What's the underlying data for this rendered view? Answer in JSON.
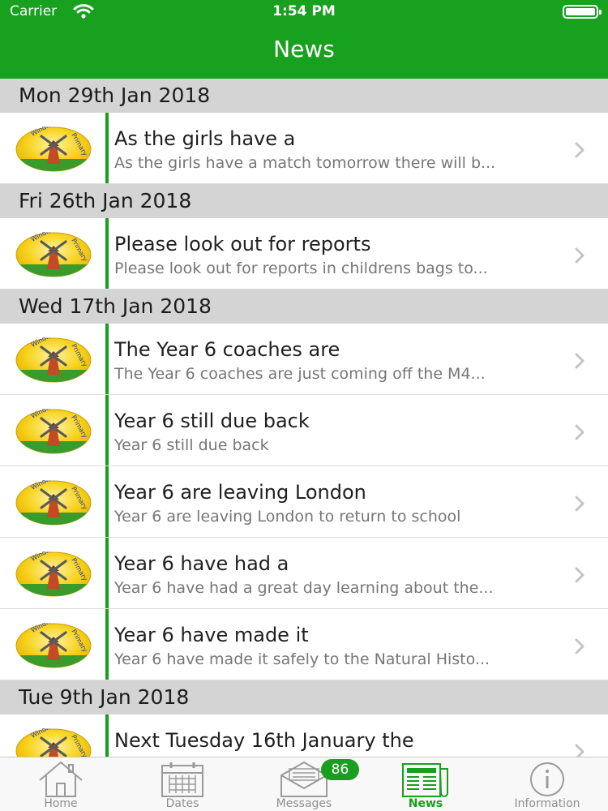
{
  "status_bar": {
    "carrier": "Carrier",
    "time": "1:54 PM"
  },
  "nav": {
    "title": "News"
  },
  "logo": {
    "text_top": "Windmill",
    "text_side": "Primary"
  },
  "colors": {
    "accent": "#17a11e",
    "section_bg": "#d4d4d4",
    "subtitle": "#767676"
  },
  "sections": [
    {
      "date": "Mon 29th Jan 2018",
      "items": [
        {
          "title": "As the girls have a",
          "subtitle": "As the girls have a match tomorrow there will b..."
        }
      ]
    },
    {
      "date": "Fri 26th Jan 2018",
      "items": [
        {
          "title": "Please look out for reports",
          "subtitle": "Please look out for reports in childrens bags to..."
        }
      ]
    },
    {
      "date": "Wed 17th Jan 2018",
      "items": [
        {
          "title": "The Year 6 coaches are",
          "subtitle": "The Year 6 coaches are just coming off the M4..."
        },
        {
          "title": "Year 6 still due back",
          "subtitle": "Year 6 still due back"
        },
        {
          "title": "Year 6 are leaving London",
          "subtitle": "Year 6 are leaving London to return to school"
        },
        {
          "title": "Year 6 have had a",
          "subtitle": "Year 6 have had a great day learning about the..."
        },
        {
          "title": "Year 6 have made it",
          "subtitle": "Year 6 have made it safely to the Natural Histo..."
        }
      ]
    },
    {
      "date": "Tue 9th Jan 2018",
      "items": [
        {
          "title": "Next Tuesday 16th January the",
          "subtitle": ""
        }
      ]
    }
  ],
  "tabs": [
    {
      "label": "Home",
      "icon": "home-icon"
    },
    {
      "label": "Dates",
      "icon": "calendar-icon"
    },
    {
      "label": "Messages",
      "icon": "envelope-icon"
    },
    {
      "label": "News",
      "icon": "newspaper-icon"
    },
    {
      "label": "Information",
      "icon": "info-icon"
    }
  ],
  "messages_badge": "86",
  "active_tab": "News"
}
